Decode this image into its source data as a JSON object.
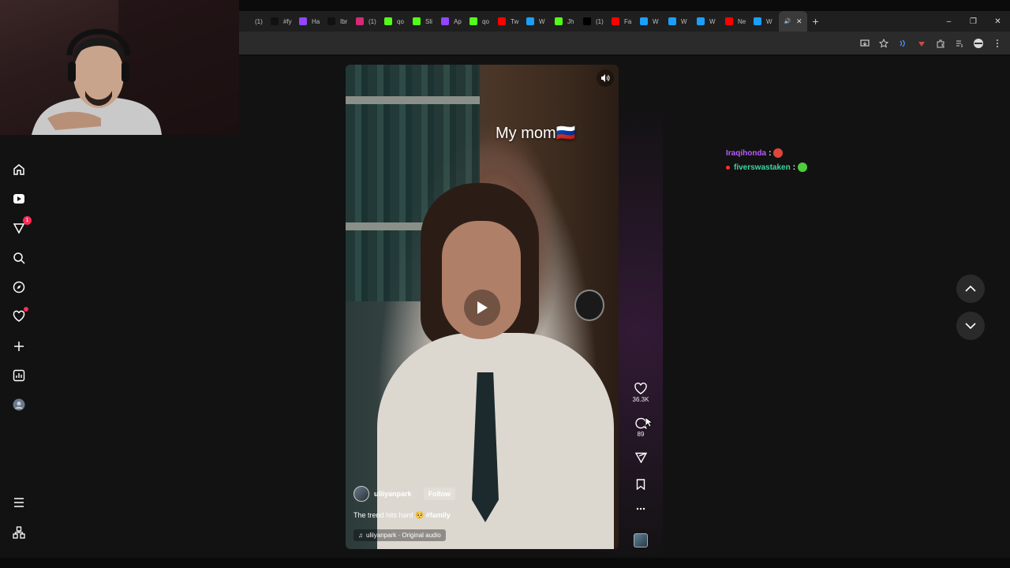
{
  "browser": {
    "tabs": [
      {
        "label": "(1)",
        "icon": "tab-icon",
        "color": "#1f1f1f"
      },
      {
        "label": "#fy",
        "icon": "tiktok-icon",
        "color": "#111111"
      },
      {
        "label": "Ha",
        "icon": "twitch-icon",
        "color": "#9146ff"
      },
      {
        "label": "Ibr",
        "icon": "tiktok-icon",
        "color": "#111111"
      },
      {
        "label": "(1)",
        "icon": "instagram-icon",
        "color": "#d62976"
      },
      {
        "label": "qo",
        "icon": "kick-icon",
        "color": "#53fc18"
      },
      {
        "label": "Sli",
        "icon": "kick-icon",
        "color": "#53fc18"
      },
      {
        "label": "Ap",
        "icon": "twitch-icon",
        "color": "#9146ff"
      },
      {
        "label": "qo",
        "icon": "kick-icon",
        "color": "#53fc18"
      },
      {
        "label": "Tw",
        "icon": "youtube-icon",
        "color": "#ff0000"
      },
      {
        "label": "W",
        "icon": "web-icon",
        "color": "#1a9fff"
      },
      {
        "label": "Jh",
        "icon": "kick-icon",
        "color": "#53fc18"
      },
      {
        "label": "(1)",
        "icon": "x-icon",
        "color": "#000000"
      },
      {
        "label": "Fa",
        "icon": "youtube-icon",
        "color": "#ff0000"
      },
      {
        "label": "W",
        "icon": "web-icon",
        "color": "#1a9fff"
      },
      {
        "label": "W",
        "icon": "web-icon",
        "color": "#1a9fff"
      },
      {
        "label": "W",
        "icon": "web-icon",
        "color": "#1a9fff"
      },
      {
        "label": "Ne",
        "icon": "youtube-icon",
        "color": "#ff0000"
      },
      {
        "label": "W",
        "icon": "web-icon",
        "color": "#1a9fff"
      }
    ],
    "new_tab": "+",
    "window_controls": {
      "minimize": "–",
      "restore": "❐",
      "close": "✕"
    }
  },
  "sidebar": {
    "notification_count": "1",
    "items": [
      "home-icon",
      "youtube-icon",
      "inbox-icon",
      "search-icon",
      "explore-icon",
      "activity-icon",
      "upload-icon",
      "analytics-icon",
      "profile-avatar",
      "menu-icon",
      "apps-icon"
    ]
  },
  "video": {
    "overlay_caption": "My mom🇷🇺",
    "author": "uliiyanpark",
    "separator": "•",
    "follow_label": "Follow",
    "description": "The trend hits hard 🥺 ",
    "hashtag": "#family",
    "music": "uliiyanpark · Original audio"
  },
  "actions": {
    "likes": "36.3K",
    "comments": "89"
  },
  "chat": [
    {
      "user": "Iraqihonda",
      "sep": ":",
      "color": "#b65cff",
      "emote_color": "#e0453b"
    },
    {
      "user": "fiverswastaken",
      "sep": ":",
      "color": "#3ad9a0",
      "emote_color": "#4ccf3a"
    }
  ],
  "colors": {
    "accent": "#fe2c55",
    "page_bg": "#121212"
  }
}
